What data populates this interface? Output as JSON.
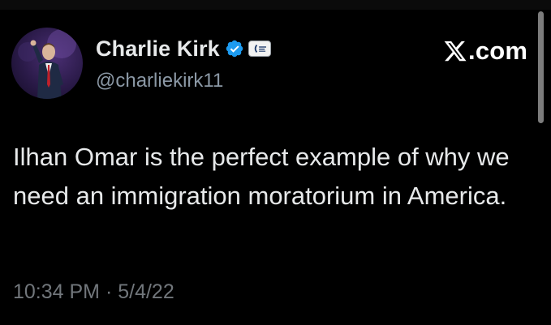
{
  "author": {
    "display_name": "Charlie Kirk",
    "handle": "@charliekirk11",
    "verified": true,
    "verified_color": "#1d9bf0"
  },
  "brand": {
    "text": ".com",
    "icon": "x-logo-icon"
  },
  "tweet": {
    "text": "Ilhan Omar is the perfect example of why we need an immigration moratorium in America.",
    "time": "10:34 PM",
    "separator": " · ",
    "date": "5/4/22"
  },
  "colors": {
    "background": "#000000",
    "text": "#e7e9ea",
    "muted": "#71767b",
    "handle": "#8b98a5"
  }
}
